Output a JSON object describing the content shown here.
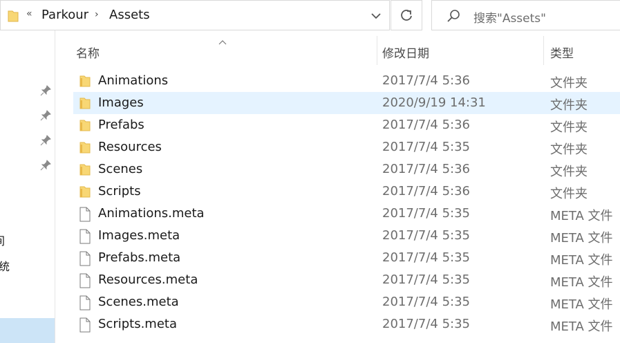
{
  "address_bar": {
    "overflow_chevron": "«",
    "crumbs": [
      "Parkour",
      "Assets"
    ],
    "separator": "›"
  },
  "search": {
    "placeholder": "搜索\"Assets\""
  },
  "nav": {
    "fragments": [
      "间",
      "统"
    ]
  },
  "columns": {
    "name": "名称",
    "date": "修改日期",
    "type": "类型"
  },
  "files": [
    {
      "name": "Animations",
      "date": "2017/7/4 5:36",
      "type": "文件夹",
      "icon": "folder-icon"
    },
    {
      "name": "Images",
      "date": "2020/9/19 14:31",
      "type": "文件夹",
      "icon": "folder-icon",
      "selected": true
    },
    {
      "name": "Prefabs",
      "date": "2017/7/4 5:36",
      "type": "文件夹",
      "icon": "folder-icon"
    },
    {
      "name": "Resources",
      "date": "2017/7/4 5:35",
      "type": "文件夹",
      "icon": "folder-icon"
    },
    {
      "name": "Scenes",
      "date": "2017/7/4 5:36",
      "type": "文件夹",
      "icon": "folder-icon"
    },
    {
      "name": "Scripts",
      "date": "2017/7/4 5:36",
      "type": "文件夹",
      "icon": "folder-icon"
    },
    {
      "name": "Animations.meta",
      "date": "2017/7/4 5:35",
      "type": "META 文件",
      "icon": "file-icon"
    },
    {
      "name": "Images.meta",
      "date": "2017/7/4 5:35",
      "type": "META 文件",
      "icon": "file-icon"
    },
    {
      "name": "Prefabs.meta",
      "date": "2017/7/4 5:35",
      "type": "META 文件",
      "icon": "file-icon"
    },
    {
      "name": "Resources.meta",
      "date": "2017/7/4 5:35",
      "type": "META 文件",
      "icon": "file-icon"
    },
    {
      "name": "Scenes.meta",
      "date": "2017/7/4 5:35",
      "type": "META 文件",
      "icon": "file-icon"
    },
    {
      "name": "Scripts.meta",
      "date": "2017/7/4 5:35",
      "type": "META 文件",
      "icon": "file-icon"
    }
  ],
  "colors": {
    "selected_row": "#e5f3ff",
    "folder": "#f8d775",
    "accent": "#cce4f7"
  }
}
